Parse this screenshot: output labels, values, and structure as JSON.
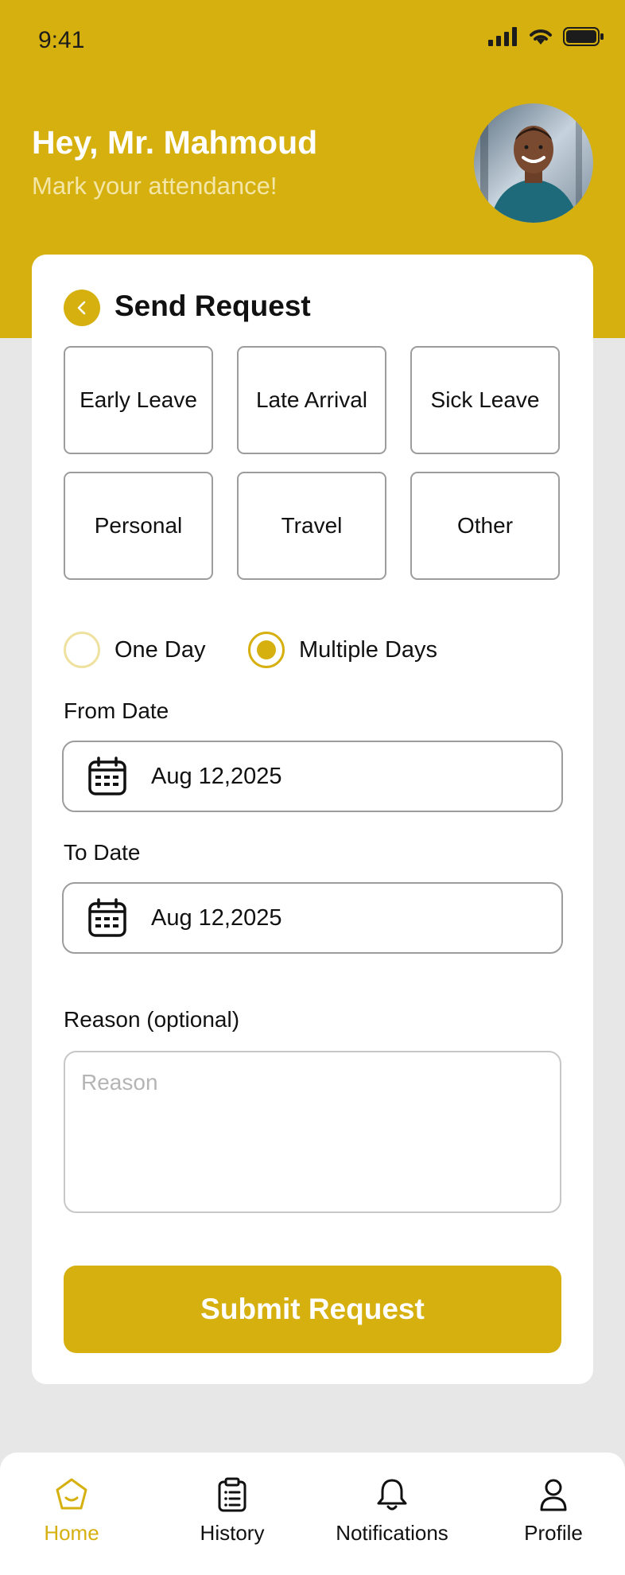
{
  "status_bar": {
    "time": "9:41"
  },
  "header": {
    "greeting": "Hey, Mr. Mahmoud",
    "subtitle": "Mark your attendance!"
  },
  "card": {
    "title": "Send Request",
    "request_types": [
      "Early Leave",
      "Late Arrival",
      "Sick Leave",
      "Personal",
      "Travel",
      "Other"
    ],
    "duration_options": [
      {
        "label": "One Day",
        "selected": false
      },
      {
        "label": "Multiple Days",
        "selected": true
      }
    ],
    "from_date": {
      "label": "From Date",
      "value": "Aug 12,2025"
    },
    "to_date": {
      "label": "To Date",
      "value": "Aug 12,2025"
    },
    "reason": {
      "label": "Reason (optional)",
      "placeholder": "Reason"
    },
    "submit_label": "Submit Request"
  },
  "nav": {
    "items": [
      {
        "label": "Home",
        "icon": "home-icon",
        "active": true
      },
      {
        "label": "History",
        "icon": "clipboard-icon",
        "active": false
      },
      {
        "label": "Notifications",
        "icon": "bell-icon",
        "active": false
      },
      {
        "label": "Profile",
        "icon": "user-icon",
        "active": false
      }
    ]
  },
  "colors": {
    "accent": "#d6b00f",
    "background": "#e7e7e7"
  }
}
